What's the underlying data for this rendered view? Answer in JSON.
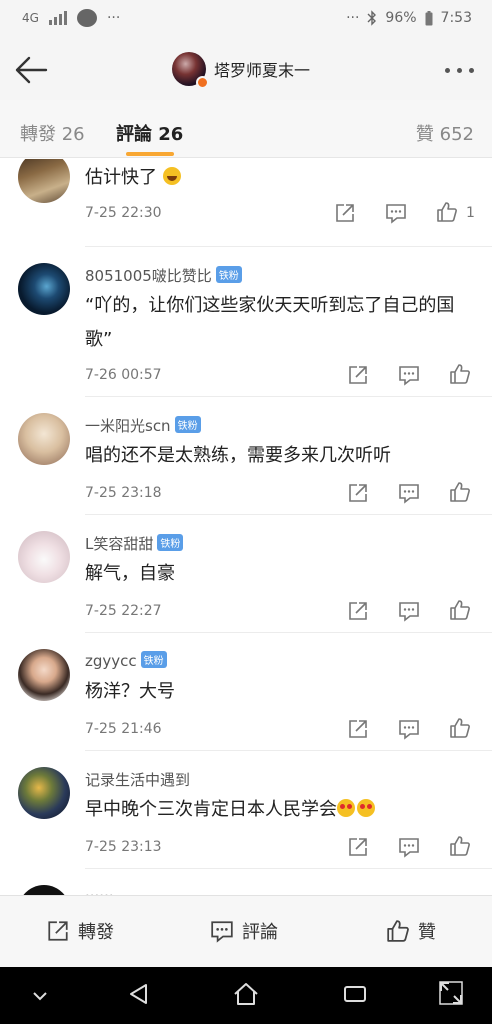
{
  "status_bar": {
    "network": "4G",
    "dots_left": "···",
    "dots_right": "···",
    "battery": "96%",
    "time": "7:53"
  },
  "nav": {
    "title": "塔罗师夏末一",
    "back_icon": "arrow-left-icon",
    "more_icon": "more-dots-icon"
  },
  "tabs": {
    "repost": "轉發 26",
    "comment": "評論 26",
    "like": "贊 652",
    "accent": "#f8a733"
  },
  "comments": [
    {
      "user": "",
      "text": "估计快了",
      "emoji": "laugh",
      "time": "7-25 22:30",
      "likes": "1"
    },
    {
      "user": "8051005啵比赞比",
      "badge": "铁粉",
      "text": "“吖的，让你们这些家伙天天听到忘了自己的国歌”",
      "time": "7-26 00:57",
      "likes": ""
    },
    {
      "user": "一米阳光scn",
      "badge": "铁粉",
      "text": "唱的还不是太熟练，需要多来几次听听",
      "time": "7-25 23:18",
      "likes": ""
    },
    {
      "user": "L笑容甜甜",
      "badge": "铁粉",
      "text": "解气，自豪",
      "time": "7-25 22:27",
      "likes": ""
    },
    {
      "user": "zgyycc",
      "badge": "铁粉",
      "text": "杨洋？大号",
      "time": "7-25 21:46",
      "likes": ""
    },
    {
      "user": "记录生活中遇到",
      "text": "早中晚个三次肯定日本人民学会",
      "emoji": "heart-eyes",
      "time": "7-25 23:13",
      "likes": ""
    }
  ],
  "bottom_bar": {
    "repost": "轉發",
    "comment": "評論",
    "like": "贊"
  },
  "system_nav": {
    "icons": [
      "chevron-down-icon",
      "back-triangle-icon",
      "home-icon",
      "recents-icon",
      "expand-icon"
    ]
  },
  "badge_color": "#5a9ee8"
}
